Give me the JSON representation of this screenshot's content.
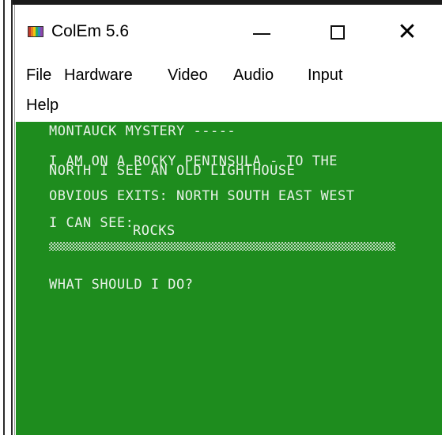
{
  "window": {
    "title": "ColEm 5.6",
    "icon_colors": [
      "#c0392b",
      "#e67e22",
      "#f1c40f",
      "#27ae60",
      "#2e86c1",
      "#8e44ad"
    ]
  },
  "menu": {
    "items": [
      {
        "label": "File"
      },
      {
        "label": "Hardware"
      },
      {
        "label": "Video"
      },
      {
        "label": "Audio"
      },
      {
        "label": "Input"
      },
      {
        "label": "Help"
      }
    ]
  },
  "game": {
    "title_line": "MONTAUCK MYSTERY -----",
    "description_line1": "I AM ON A ROCKY PENINSULA - TO THE",
    "description_line2": "NORTH I SEE AN OLD LIGHTHOUSE",
    "exits_line": "OBVIOUS EXITS: NORTH SOUTH EAST WEST",
    "can_see_label": "I CAN SEE:",
    "visible_item": "ROCKS",
    "prompt": "WHAT SHOULD I DO?",
    "background_color": "#1e8c1e",
    "text_color": "#e8f2e8"
  }
}
